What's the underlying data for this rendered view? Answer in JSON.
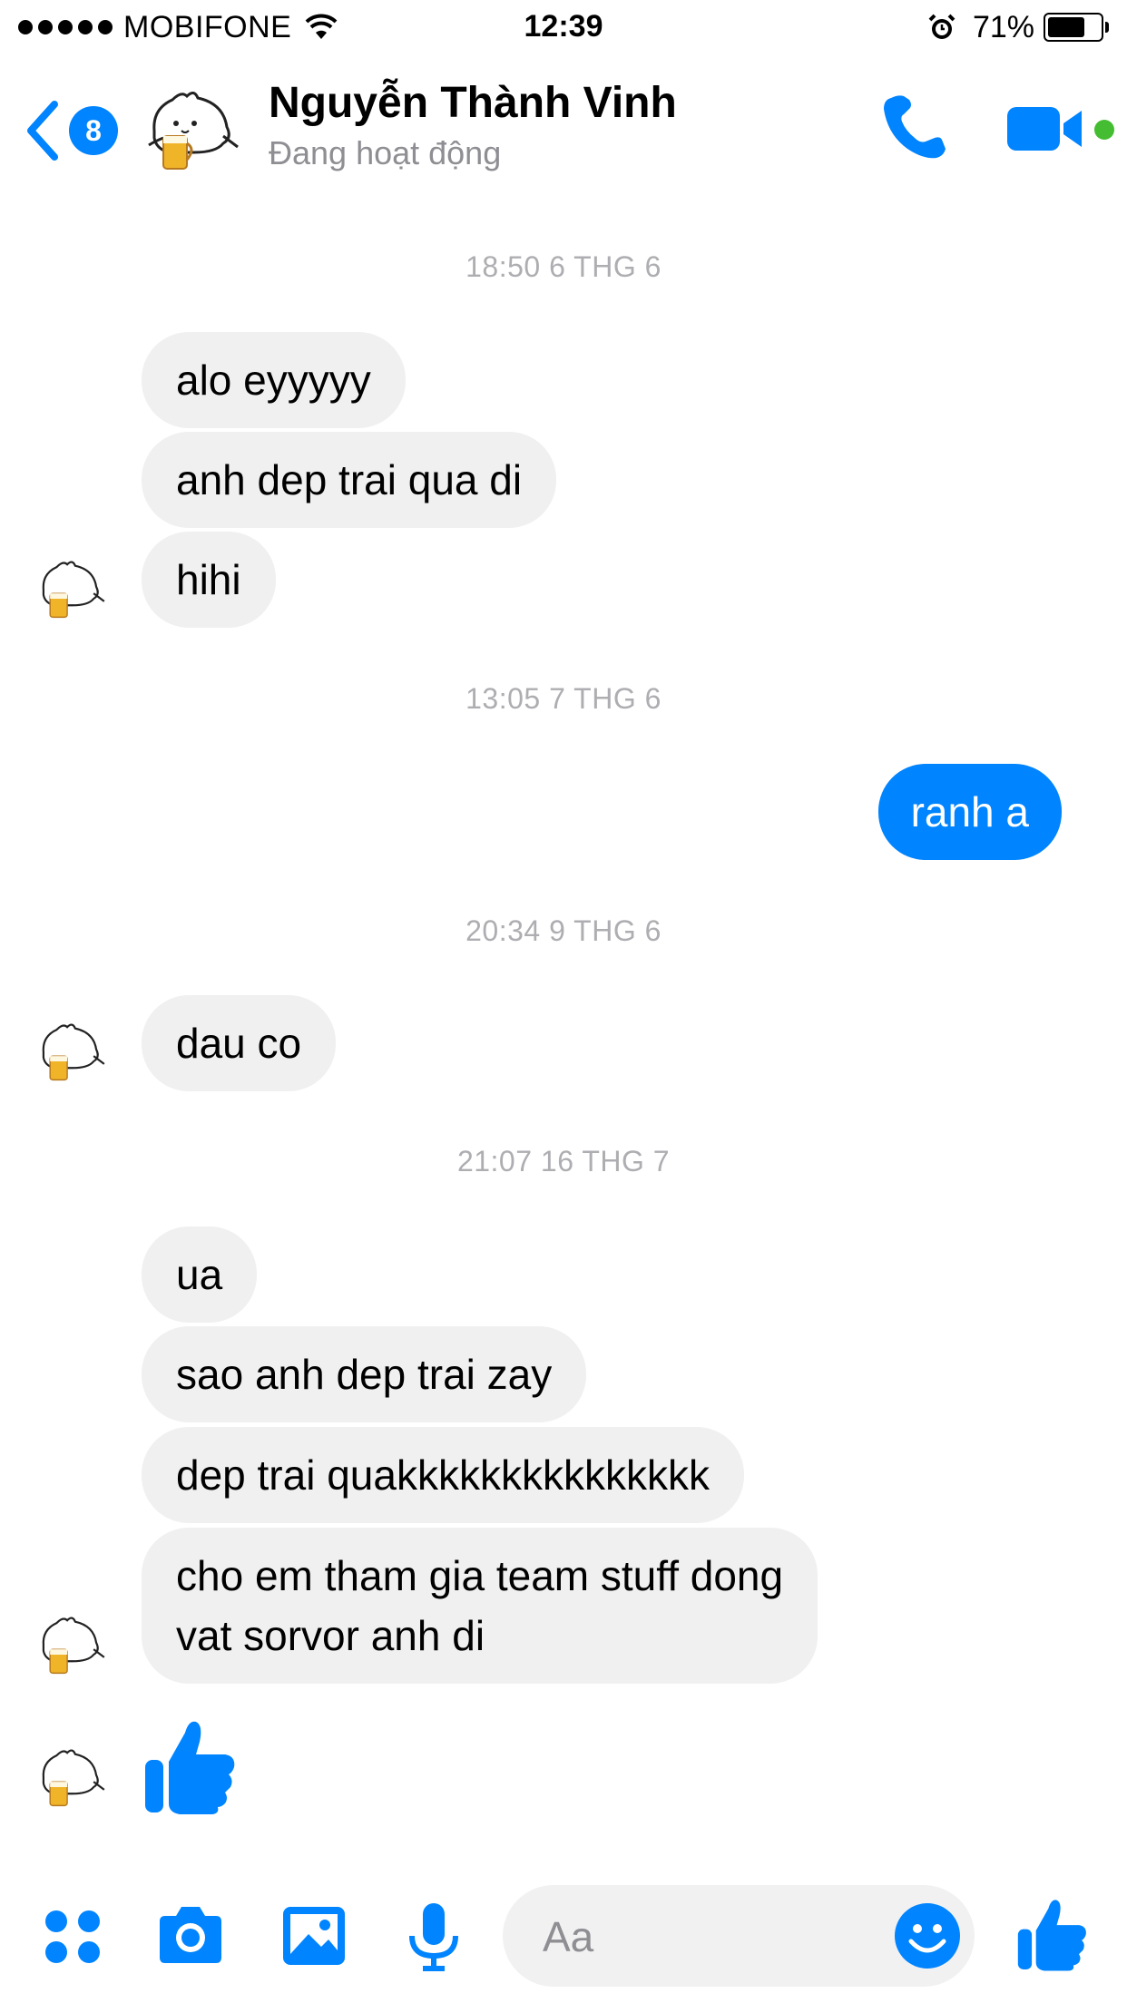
{
  "status_bar": {
    "carrier": "MOBIFONE",
    "time": "12:39",
    "battery_percent": "71%",
    "battery_level": 0.71
  },
  "header": {
    "unread_count": "8",
    "contact_name": "Nguyễn Thành Vinh",
    "contact_status": "Đang hoạt động",
    "icons": {
      "back": "chevron-left-icon",
      "call": "phone-icon",
      "video": "video-camera-icon",
      "online": "online-dot"
    },
    "accent_color": "#0084ff",
    "online_color": "#44bd32"
  },
  "conversation": {
    "timestamps": [
      "18:50 6 THG 6",
      "13:05 7 THG 6",
      "20:34 9 THG 6",
      "21:07 16 THG 7"
    ],
    "group1": [
      "alo eyyyyy",
      "anh dep trai qua di",
      "hihi"
    ],
    "group2_outgoing": [
      "ranh a"
    ],
    "group3": [
      "dau co"
    ],
    "group4": [
      "ua",
      "sao anh dep trai zay",
      "dep trai quakkkkkkkkkkkkkkk",
      "cho em tham gia team stuff dong\nvat sorvor anh di"
    ],
    "sticker": "thumbs-up-icon",
    "incoming_bubble_color": "#f0f0f0",
    "outgoing_bubble_color": "#0084ff"
  },
  "composer": {
    "placeholder": "Aa",
    "tools": [
      "apps-grid-icon",
      "camera-icon",
      "image-icon",
      "microphone-icon"
    ],
    "emoji": "smiley-icon",
    "send_like": "thumbs-up-icon"
  }
}
